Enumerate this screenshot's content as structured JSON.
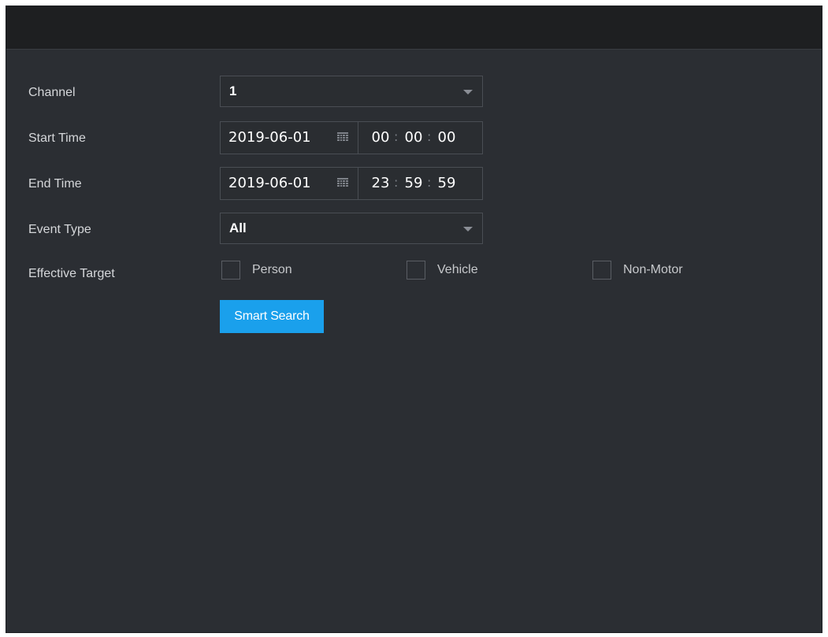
{
  "form": {
    "channel": {
      "label": "Channel",
      "value": "1"
    },
    "start_time": {
      "label": "Start Time",
      "date": "2019-06-01",
      "hour": "00",
      "minute": "00",
      "second": "00"
    },
    "end_time": {
      "label": "End Time",
      "date": "2019-06-01",
      "hour": "23",
      "minute": "59",
      "second": "59"
    },
    "event_type": {
      "label": "Event Type",
      "value": "All"
    },
    "effective_target": {
      "label": "Effective Target",
      "options": [
        {
          "label": "Person",
          "checked": false
        },
        {
          "label": "Vehicle",
          "checked": false
        },
        {
          "label": "Non-Motor",
          "checked": false
        }
      ]
    },
    "time_separator": ":",
    "search_button_label": "Smart Search"
  },
  "icons": {
    "calendar": "calendar-icon",
    "dropdown": "chevron-down-icon"
  },
  "colors": {
    "panel_background": "#2b2e33",
    "titlebar_background": "#1e1f21",
    "accent_button": "#1aa0ec",
    "text": "#d5d7da"
  }
}
